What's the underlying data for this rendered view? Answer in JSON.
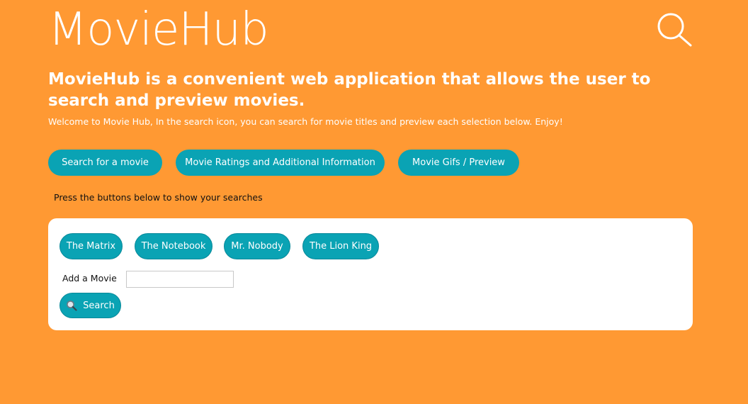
{
  "header": {
    "logo": "MovieHub",
    "search_icon": "search-icon"
  },
  "intro": {
    "tagline": "MovieHub is a convenient web application that allows the user to search and preview movies.",
    "welcome": "Welcome to Movie Hub, In the search icon, you can search for movie titles and preview each selection below. Enjoy!"
  },
  "nav": {
    "buttons": [
      {
        "label": "Search for a movie"
      },
      {
        "label": "Movie Ratings and Additional Information"
      },
      {
        "label": "Movie Gifs / Preview"
      }
    ]
  },
  "hint": "Press the buttons below to show your searches",
  "panel": {
    "movies": [
      {
        "label": "The Matrix"
      },
      {
        "label": "The Notebook"
      },
      {
        "label": "Mr. Nobody"
      },
      {
        "label": "The Lion King"
      }
    ],
    "add_label": "Add a Movie",
    "add_value": "",
    "search_label": "Search",
    "search_icon": "magnifier-icon"
  },
  "colors": {
    "background": "#ff9933",
    "accent": "#0aa3b4",
    "text_light": "#ffffff"
  }
}
